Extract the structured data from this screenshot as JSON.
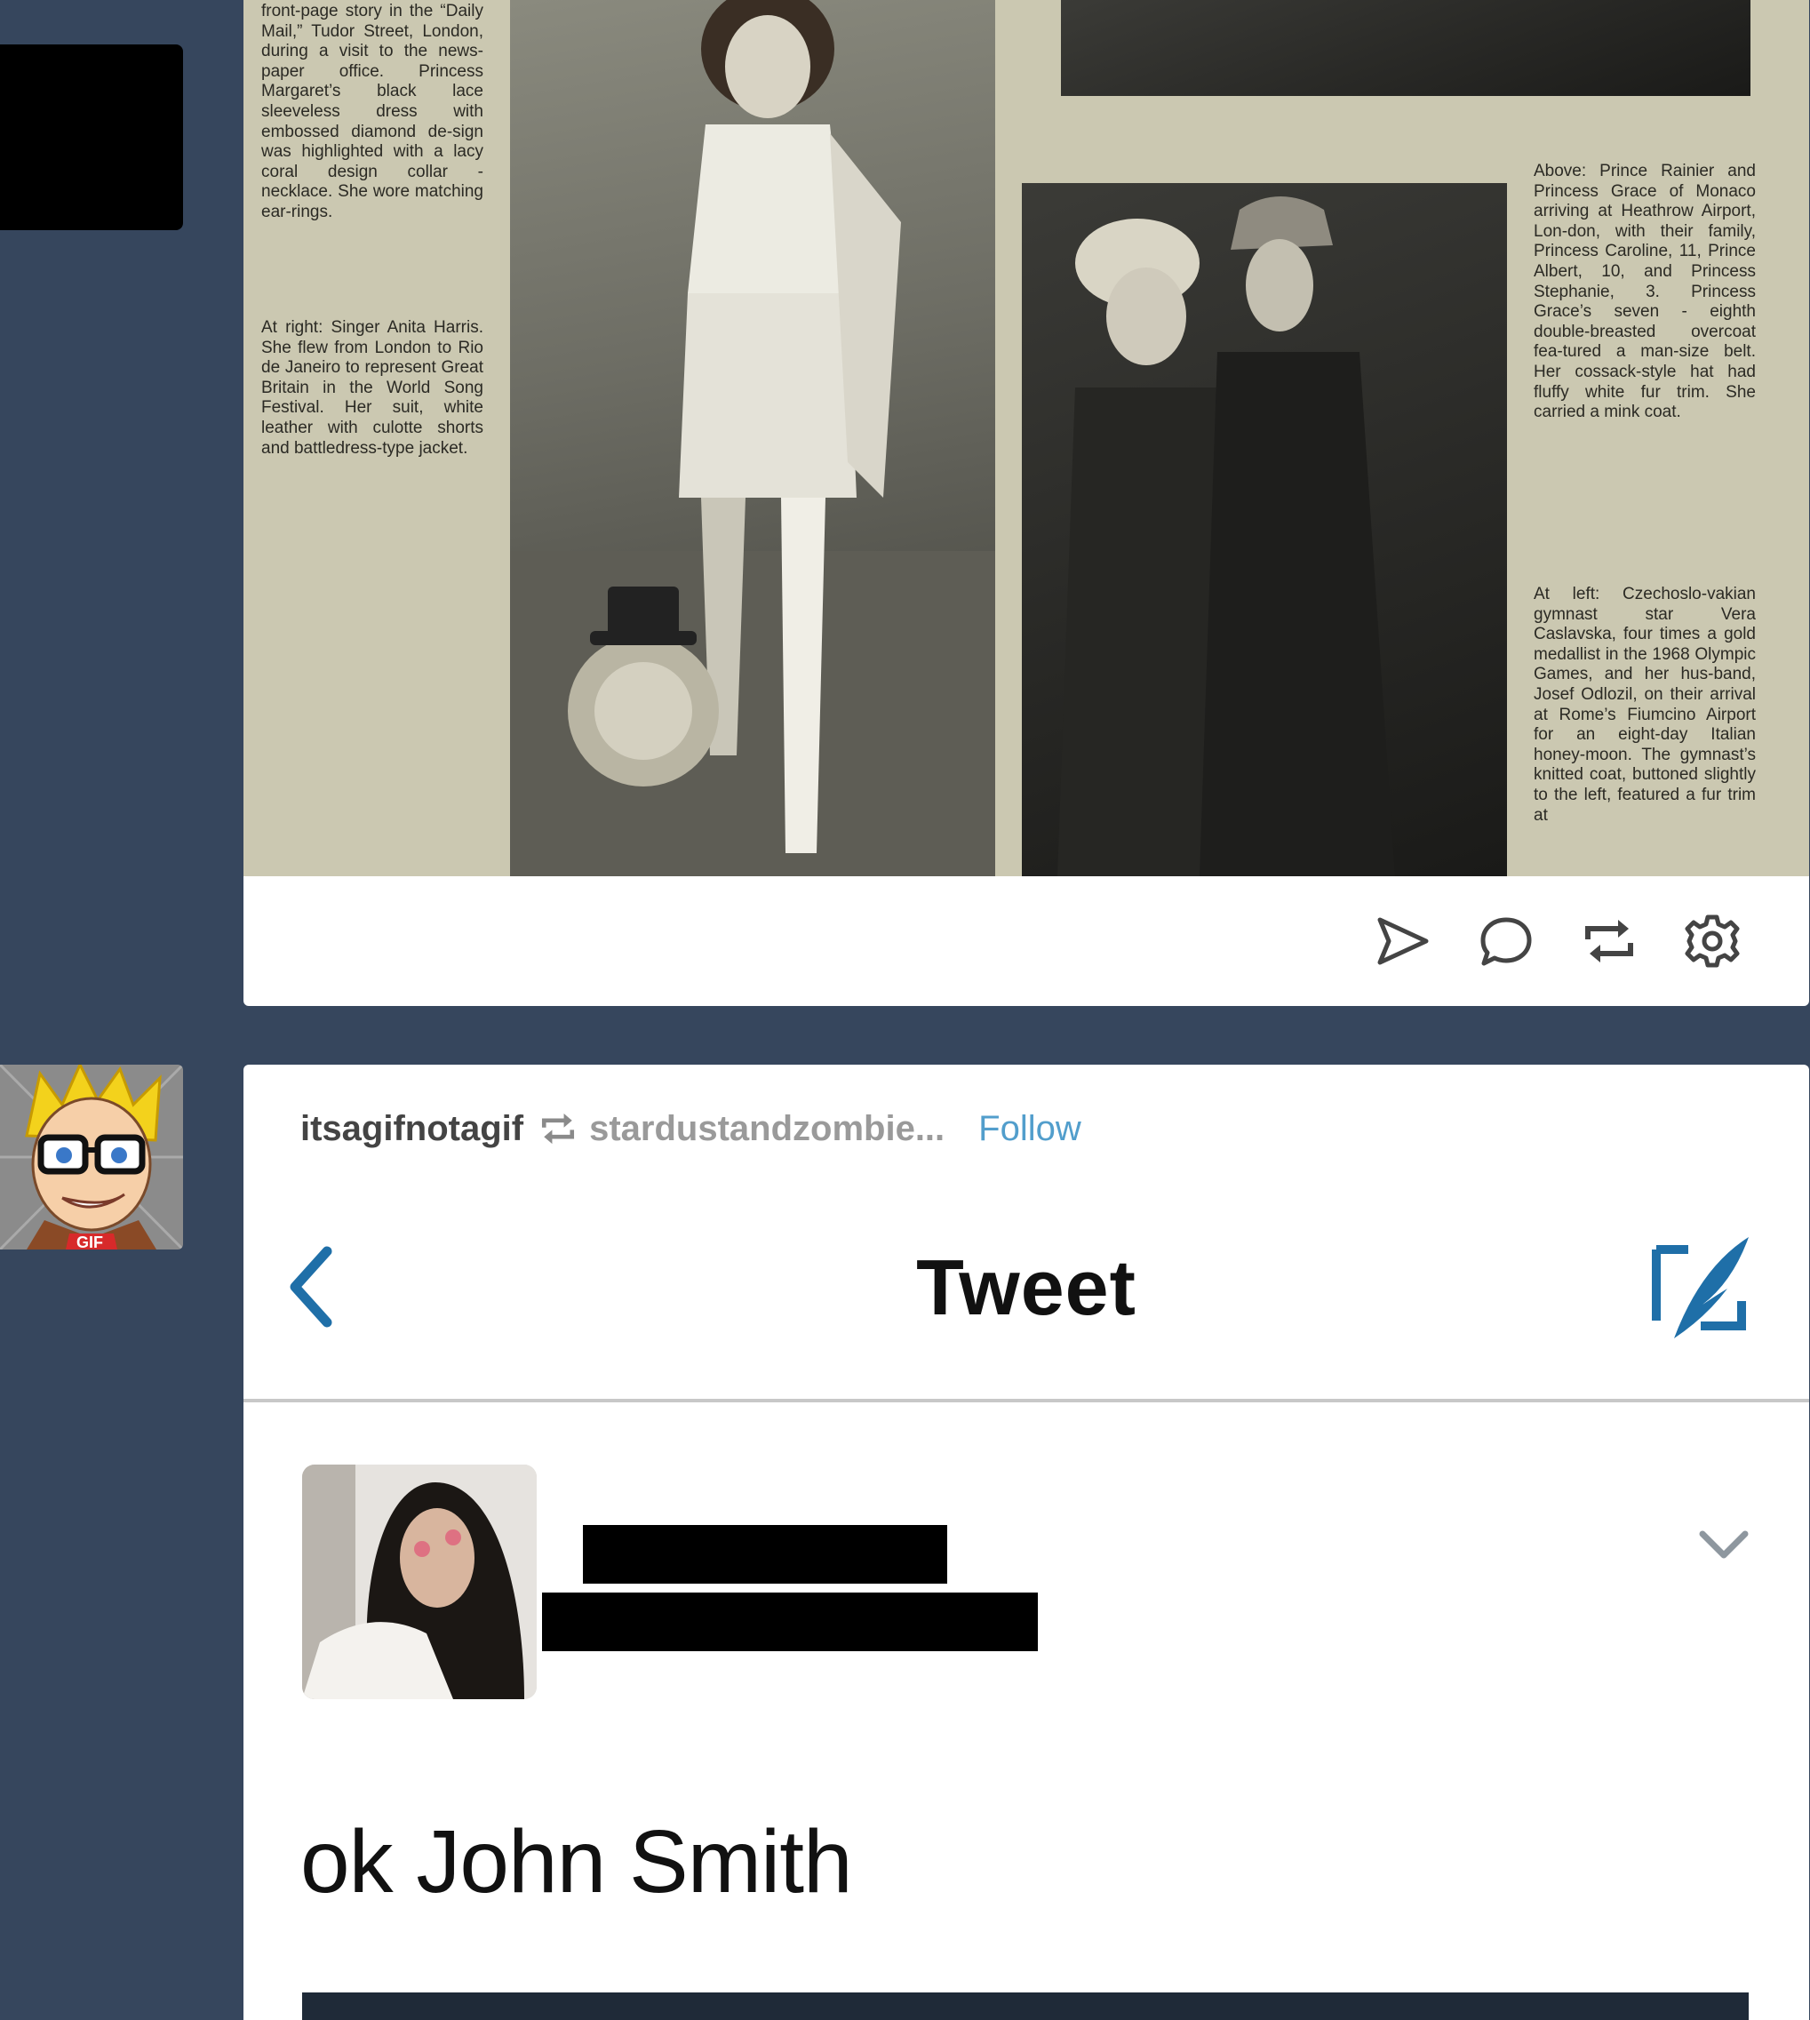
{
  "post1": {
    "clipping_captions": {
      "col_left_top": "front-page story in the “Daily Mail,” Tudor Street, London, during a visit to the news-paper office. Princess Margaret’s black lace sleeveless dress with embossed diamond de-sign was highlighted with a lacy coral design collar - necklace. She wore matching ear-rings.",
      "col_left_bottom": "At right: Singer Anita Harris. She flew from London to Rio de Janeiro to represent Great Britain in the World Song Festival. Her suit, white leather with culotte shorts and battledress-type jacket.",
      "col_right_top": "Above: Prince Rainier and Princess Grace of Monaco arriving at Heathrow Airport, Lon-don, with their family, Princess Caroline, 11, Prince Albert, 10, and Princess Stephanie, 3. Princess Grace’s seven - eighth double-breasted overcoat fea-tured a man-size belt. Her cossack-style hat had fluffy white fur trim. She carried a mink coat.",
      "col_right_bottom": "At left: Czechoslo-vakian gymnast star Vera Caslavska, four times a gold medallist in the 1968 Olympic Games, and her hus-band, Josef Odlozil, on their arrival at Rome’s Fiumcino Airport for an eight-day Italian honey-moon. The gymnast’s knitted coat, buttoned slightly to the left, featured a fur trim at"
    },
    "actions": [
      "share-icon",
      "reply-icon",
      "reblog-icon",
      "settings-icon"
    ]
  },
  "post2": {
    "author": "itsagifnotagif",
    "reblogged_from": "stardustandzombie...",
    "follow_label": "Follow",
    "tweet_screen": {
      "title": "Tweet",
      "back_icon": "chevron-left-icon",
      "compose_icon": "compose-icon",
      "body_text": "ok John Smith",
      "menu_icon": "chevron-down-icon"
    }
  },
  "colors": {
    "dashboard_bg": "#36465d",
    "card_bg": "#ffffff",
    "follow_link": "#529ecc",
    "tweet_accent": "#1f6fa8"
  }
}
